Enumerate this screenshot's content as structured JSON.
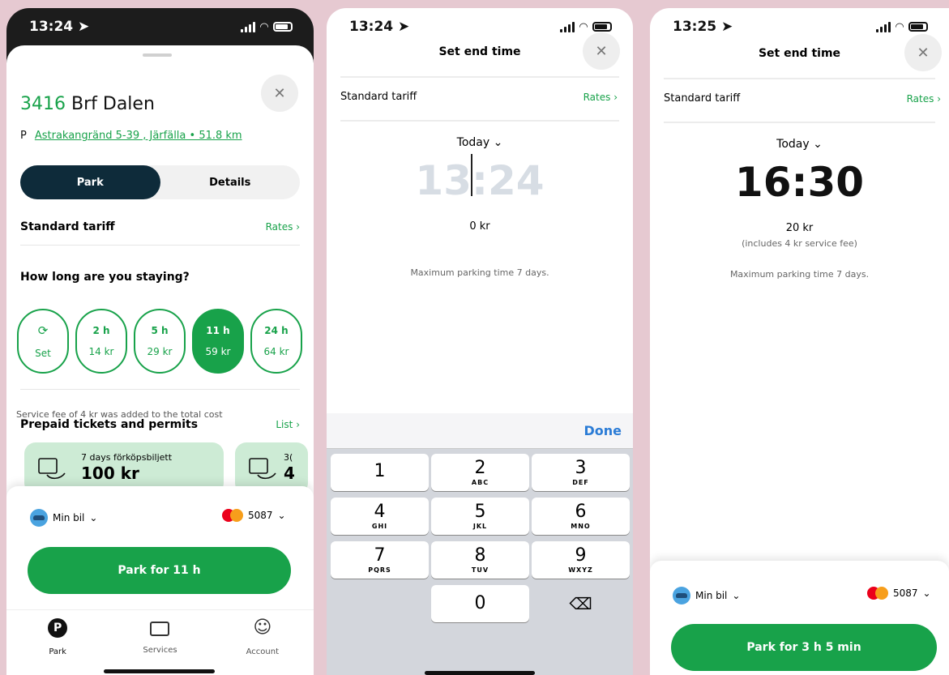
{
  "phone1": {
    "status_time": "13:24",
    "zone_number": "3416",
    "zone_name": "Brf Dalen",
    "address_prefix": "P",
    "address": "Astrakangränd 5-39 , Järfälla • 51.8 km",
    "tabs": [
      "Park",
      "Details"
    ],
    "tariff_label": "Standard tariff",
    "rates_link": "Rates",
    "question": "How long are you staying?",
    "durations": [
      {
        "top": "Set",
        "bottom": "",
        "icon": "clock-icon"
      },
      {
        "top": "2 h",
        "bottom": "14 kr"
      },
      {
        "top": "5 h",
        "bottom": "29 kr"
      },
      {
        "top": "11 h",
        "bottom": "59 kr",
        "selected": true
      },
      {
        "top": "24 h",
        "bottom": "64 kr"
      }
    ],
    "service_fee_note": "Service fee of 4 kr was added to the total cost",
    "prepaid_title": "Prepaid tickets and permits",
    "list_link": "List",
    "tickets": [
      {
        "name": "7 days förköpsbiljett",
        "price": "100 kr"
      },
      {
        "name": "3(",
        "price": "4"
      }
    ],
    "vehicle": "Min bil",
    "card": "5087",
    "cta": "Park for 11 h",
    "nav": [
      {
        "label": "Park",
        "icon": "park-p-icon"
      },
      {
        "label": "Services",
        "icon": "ticket-icon"
      },
      {
        "label": "Account",
        "icon": "smiley-icon"
      }
    ]
  },
  "phone2": {
    "status_time": "13:24",
    "title": "Set end time",
    "tariff_label": "Standard tariff",
    "rates_link": "Rates",
    "date": "Today",
    "time_placeholder": "13:24",
    "price": "0 kr",
    "max_note": "Maximum parking time 7 days.",
    "done": "Done",
    "keys": [
      {
        "d": "1",
        "s": ""
      },
      {
        "d": "2",
        "s": "ABC"
      },
      {
        "d": "3",
        "s": "DEF"
      },
      {
        "d": "4",
        "s": "GHI"
      },
      {
        "d": "5",
        "s": "JKL"
      },
      {
        "d": "6",
        "s": "MNO"
      },
      {
        "d": "7",
        "s": "PQRS"
      },
      {
        "d": "8",
        "s": "TUV"
      },
      {
        "d": "9",
        "s": "WXYZ"
      },
      {
        "d": "0",
        "s": ""
      }
    ]
  },
  "phone3": {
    "status_time": "13:25",
    "title": "Set end time",
    "tariff_label": "Standard tariff",
    "rates_link": "Rates",
    "date": "Today",
    "time": "16:30",
    "price": "20 kr",
    "fee_note": "(includes 4 kr service fee)",
    "max_note": "Maximum parking time 7 days.",
    "vehicle": "Min bil",
    "card": "5087",
    "cta": "Park for 3 h 5 min"
  },
  "colors": {
    "accent": "#18a24a",
    "dark": "#0e2b3a",
    "ios_blue": "#2b7cd6"
  }
}
